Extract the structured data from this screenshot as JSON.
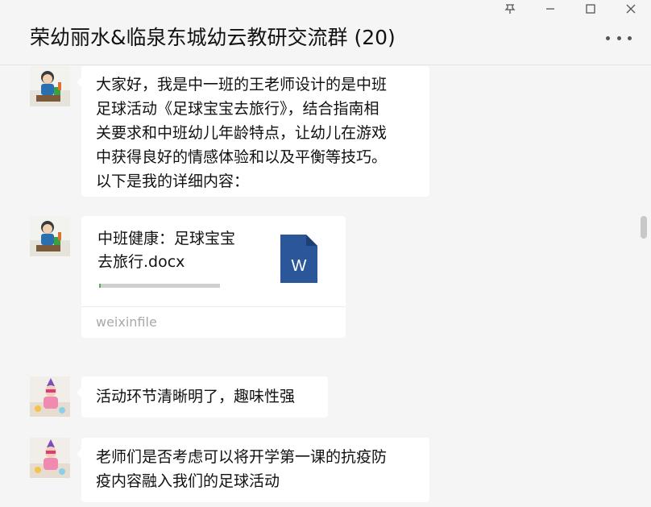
{
  "window": {
    "controls": [
      "pin",
      "minimize",
      "maximize",
      "close"
    ]
  },
  "header": {
    "title": "荣幼丽水&临泉东城幼云教研交流群 (20)",
    "more_icon": "more-dots-icon"
  },
  "messages": [
    {
      "type": "text",
      "avatar": "avatar-teacher-sculpture",
      "lines": [
        "大家好，我是中一班的王老师设计的是中班",
        "足球活动《足球宝宝去旅行》，结合指南相",
        "关要求和中班幼儿年龄特点，让幼儿在游戏",
        "中获得良好的情感体验和以及平衡等技巧。",
        "以下是我的详细内容："
      ]
    },
    {
      "type": "file",
      "avatar": "avatar-teacher-sculpture",
      "file_name_lines": [
        "中班健康：足球宝宝",
        "去旅行.docx"
      ],
      "file_icon": "word-document-icon",
      "file_icon_letter": "W",
      "progress": 0.01,
      "source": "weixinfile"
    },
    {
      "type": "text",
      "avatar": "avatar-child-party",
      "lines": [
        "活动环节清晰明了，趣味性强"
      ]
    },
    {
      "type": "text",
      "avatar": "avatar-child-party",
      "lines": [
        "老师们是否考虑可以将开学第一课的抗疫防",
        "疫内容融入我们的足球活动"
      ]
    }
  ],
  "colors": {
    "background": "#f5f5f5",
    "bubble": "#ffffff",
    "word_blue": "#2b579a",
    "progress": "#4caf50"
  }
}
